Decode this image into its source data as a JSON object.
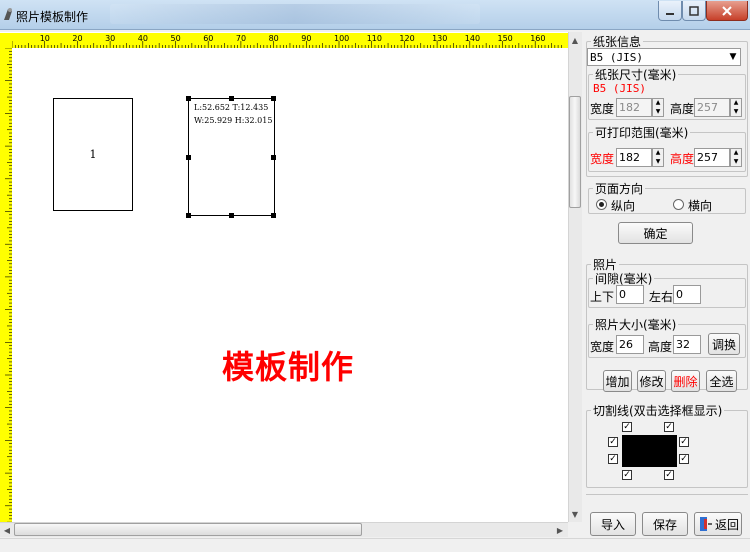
{
  "window": {
    "title": "照片模板制作"
  },
  "colors": {
    "ruler": "#ffff00",
    "accent_red": "#ff0000",
    "swatch": "#000000"
  },
  "ruler": {
    "top_ticks": [
      "10",
      "20",
      "30",
      "40",
      "50",
      "60",
      "70",
      "80",
      "90",
      "100",
      "110",
      "120",
      "130",
      "140",
      "150",
      "160"
    ]
  },
  "canvas": {
    "photo1": {
      "label": "1"
    },
    "photo2": {
      "line1": "L:52.652 T:12.435",
      "line2": "W:25.929 H:32.015"
    },
    "heading": "模板制作"
  },
  "paper": {
    "legend": "纸张信息",
    "select_value": "B5 (JIS)",
    "size_legend": "纸张尺寸(毫米)",
    "size_name": "B5 (JIS)",
    "width_label": "宽度",
    "width_value": "182",
    "height_label": "高度",
    "height_value": "257",
    "print_legend": "可打印范围(毫米)",
    "print_width_label": "宽度",
    "print_width_value": "182",
    "print_height_label": "高度",
    "print_height_value": "257",
    "orient_legend": "页面方向",
    "portrait": "纵向",
    "landscape": "横向",
    "ok": "确定"
  },
  "photo": {
    "legend": "照片",
    "gap_legend": "间隙(毫米)",
    "tb_label": "上下",
    "tb_value": "0",
    "lr_label": "左右",
    "lr_value": "0",
    "size_legend": "照片大小(毫米)",
    "w_label": "宽度",
    "w_value": "26",
    "h_label": "高度",
    "h_value": "32",
    "adjust": "调换"
  },
  "actions": {
    "add": "增加",
    "edit": "修改",
    "delete": "删除",
    "select_all": "全选"
  },
  "cutline": {
    "legend": "切割线(双击选择框显示)"
  },
  "bottom": {
    "import": "导入",
    "save": "保存",
    "back": "返回"
  }
}
